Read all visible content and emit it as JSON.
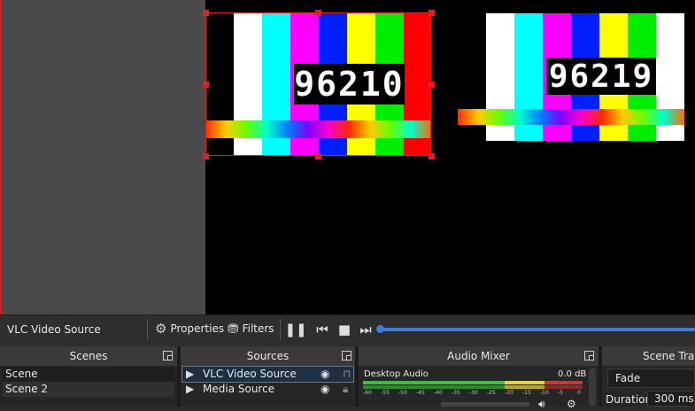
{
  "toolbar": {
    "source_name": "VLC Video Source",
    "properties_label": "Properties",
    "filters_label": "Filters",
    "properties_icon": "gear-icon",
    "filters_icon": "filter-icon",
    "seek_color": "#3b7ddd"
  },
  "preview": {
    "left_card_clock": "96210",
    "right_card_clock": "96219",
    "selection_color": "#e02020"
  },
  "scenes": {
    "title": "Scenes",
    "items": [
      {
        "label": "Scene"
      },
      {
        "label": "Scene 2"
      }
    ]
  },
  "sources": {
    "title": "Sources",
    "items": [
      {
        "label": "VLC Video Source",
        "selected": true,
        "visible": true,
        "locked": false
      },
      {
        "label": "Media Source",
        "selected": false,
        "visible": true,
        "locked": true
      }
    ]
  },
  "audio_mixer": {
    "title": "Audio Mixer",
    "channels": [
      {
        "name": "Desktop Audio",
        "level": "0.0 dB"
      }
    ],
    "scale": [
      "-60",
      "-55",
      "-50",
      "-45",
      "-40",
      "-35",
      "-30",
      "-25",
      "-20",
      "-15",
      "-10",
      "-5",
      "0"
    ]
  },
  "transitions": {
    "title": "Scene Transi",
    "type": "Fade",
    "duration_label": "Duration",
    "duration_value": "300 ms"
  }
}
